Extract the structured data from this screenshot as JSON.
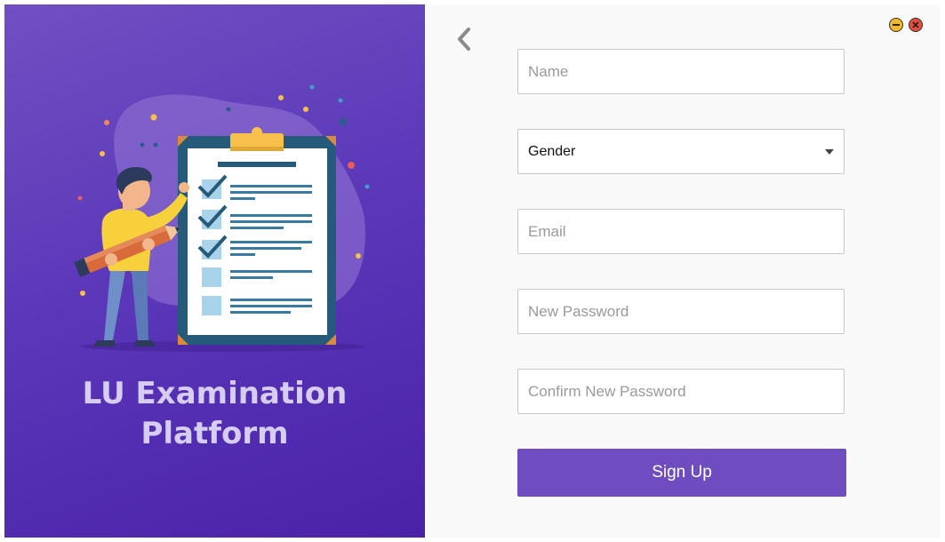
{
  "app": {
    "title_line1": "LU Examination",
    "title_line2": "Platform"
  },
  "window_controls": {
    "minimize_color": "#f3b92a",
    "close_color": "#e94b3c"
  },
  "form": {
    "name_placeholder": "Name",
    "gender_value": "Gender",
    "email_placeholder": "Email",
    "new_password_placeholder": "New Password",
    "confirm_password_placeholder": "Confirm New Password",
    "signup_label": "Sign Up"
  },
  "icons": {
    "back": "chevron-left-icon",
    "minimize": "minimize-icon",
    "close": "close-icon",
    "dropdown": "caret-down-icon"
  },
  "colors": {
    "accent": "#6f4cc0",
    "panel_top": "#7050c2",
    "panel_bottom": "#4a22a8",
    "title_text": "#d6cdf3"
  }
}
